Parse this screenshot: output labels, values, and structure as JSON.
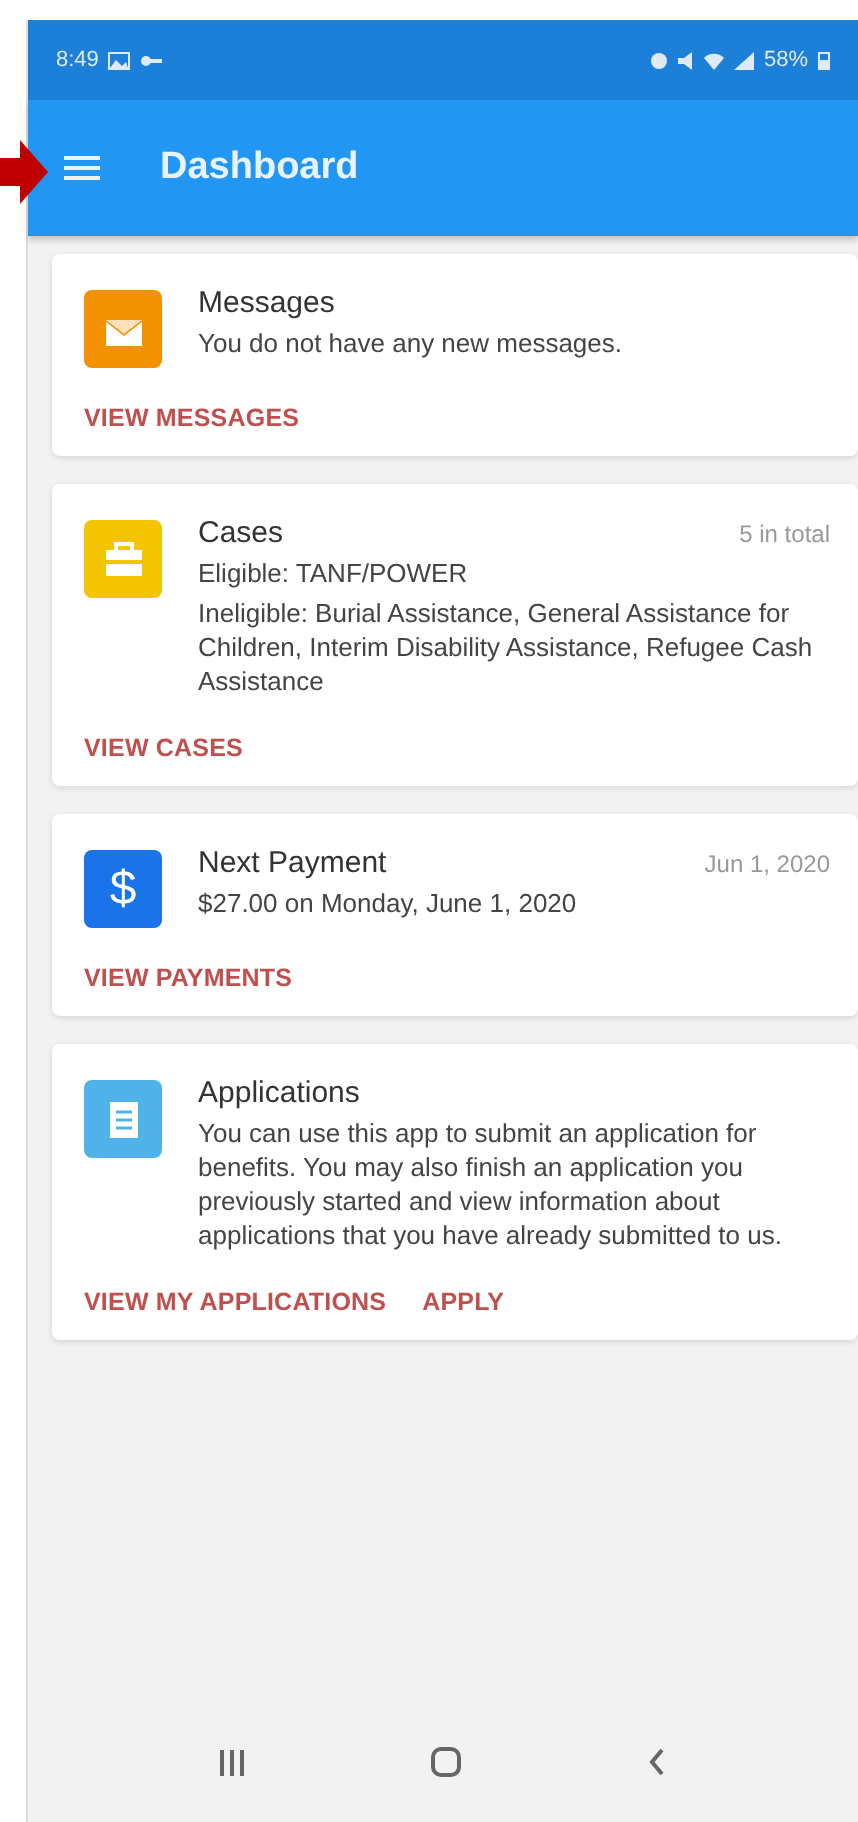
{
  "status_bar": {
    "time": "8:49",
    "battery": "58%"
  },
  "app_bar": {
    "title": "Dashboard"
  },
  "cards": [
    {
      "kind": "messages",
      "color": "#f39200",
      "title": "Messages",
      "paragraphs": [
        "You do not have any new messages."
      ],
      "actions": [
        "VIEW MESSAGES"
      ]
    },
    {
      "kind": "cases",
      "color": "#f2c500",
      "title": "Cases",
      "meta": "5 in total",
      "paragraphs": [
        "Eligible: TANF/POWER",
        "Ineligible: Burial Assistance, General Assistance for Children, Interim Disability Assistance, Refugee Cash Assistance"
      ],
      "actions": [
        "VIEW CASES"
      ]
    },
    {
      "kind": "payment",
      "color": "#1a73e8",
      "icon_text": "$",
      "title": "Next Payment",
      "meta": "Jun 1, 2020",
      "paragraphs": [
        "$27.00 on Monday, June 1, 2020"
      ],
      "actions": [
        "VIEW PAYMENTS"
      ]
    },
    {
      "kind": "applications",
      "color": "#4fb3ea",
      "title": "Applications",
      "paragraphs": [
        "You can use this app to submit an application for benefits. You may also finish an application you previously started and view information about applications that you have already submitted to us."
      ],
      "actions": [
        "VIEW MY APPLICATIONS",
        "APPLY"
      ]
    }
  ]
}
